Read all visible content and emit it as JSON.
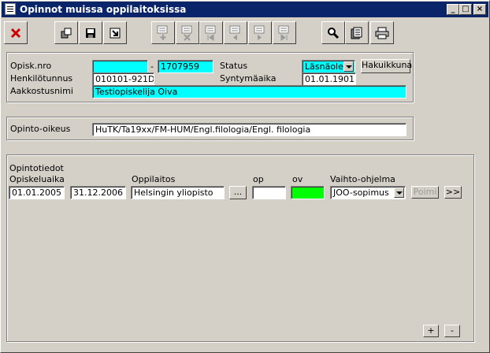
{
  "window": {
    "title": "Opinnot muissa oppilaitoksissa"
  },
  "toolbar": {
    "buttons": [
      {
        "icon": "close-icon"
      },
      {
        "icon": "copy-icon"
      },
      {
        "icon": "save-icon"
      },
      {
        "icon": "exit-icon"
      },
      {
        "icon": "add-record-icon"
      },
      {
        "icon": "delete-record-icon"
      },
      {
        "icon": "first-record-icon"
      },
      {
        "icon": "prev-record-icon"
      },
      {
        "icon": "next-record-icon"
      },
      {
        "icon": "last-record-icon"
      },
      {
        "icon": "search-icon"
      },
      {
        "icon": "document-icon"
      },
      {
        "icon": "print-icon"
      }
    ]
  },
  "student": {
    "opisk_nro_label": "Opisk.nro",
    "opisk_nro_value": "",
    "dash": "-",
    "opisk_nro_value2": "1707959",
    "status_label": "Status",
    "status_value": "Läsnäolev",
    "hakuikkuna_label": "Hakuikkuna",
    "henkilotunnus_label": "Henkilötunnus",
    "henkilotunnus_value": "010101-921D",
    "syntymaaika_label": "Syntymäaika",
    "syntymaaika_value": "01.01.1901",
    "aakkostusnimi_label": "Aakkostusnimi",
    "aakkostusnimi_value": "Testiopiskelija Oiva"
  },
  "opinto_oikeus": {
    "label": "Opinto-oikeus",
    "value": "HuTK/Ta19xx/FM-HUM/Engl.filologia/Engl. filologia"
  },
  "opintotiedot": {
    "section_label": "Opintotiedot",
    "opiskeluaika_label": "Opiskeluaika",
    "oppilaitos_label": "Oppilaitos",
    "op_label": "op",
    "ov_label": "ov",
    "vaihto_label": "Vaihto-ohjelma",
    "start_date": "01.01.2005",
    "end_date": "31.12.2006",
    "oppilaitos_value": "Helsingin yliopisto",
    "ellipsis_label": "...",
    "op_value": "",
    "ov_value": "",
    "vaihto_value": "JOO-sopimus",
    "poimi_label": "Poimi",
    "more_label": ">>",
    "plus_label": "+",
    "minus_label": "-"
  },
  "colors": {
    "required": "#00ffff",
    "ok": "#00ff00",
    "titlebar": "#0a246a"
  }
}
